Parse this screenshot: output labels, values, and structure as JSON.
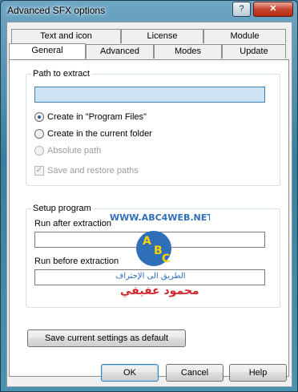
{
  "window": {
    "title": "Advanced SFX options"
  },
  "titlebar": {
    "help_label": "?",
    "close_label": "✕"
  },
  "tabs": {
    "row1": [
      "Text and icon",
      "License",
      "Module"
    ],
    "row2": [
      "General",
      "Advanced",
      "Modes",
      "Update"
    ],
    "active": "General"
  },
  "path_group": {
    "label": "Path to extract",
    "path_value": "",
    "options": [
      {
        "label": "Create in \"Program Files\"",
        "selected": true,
        "enabled": true
      },
      {
        "label": "Create in the current folder",
        "selected": false,
        "enabled": true
      },
      {
        "label": "Absolute path",
        "selected": false,
        "enabled": false
      }
    ],
    "save_restore": {
      "label": "Save and restore paths",
      "checked": true,
      "enabled": false
    }
  },
  "setup_group": {
    "label": "Setup program",
    "run_after_label": "Run after extraction",
    "run_after_value": "",
    "run_before_label": "Run before extraction",
    "run_before_value": ""
  },
  "save_default_button": "Save current settings as default",
  "footer": {
    "ok": "OK",
    "cancel": "Cancel",
    "help": "Help"
  },
  "watermark": {
    "url": "WWW.ABC4WEB.NET",
    "logo_letters": [
      "A",
      "B",
      "C"
    ],
    "arabic_line1": "الطريق الى الإحتراف",
    "arabic_line2": "محمود عفيفي"
  },
  "colors": {
    "focused_field": "#cbe3f5",
    "watermark_blue": "#2f6fb8",
    "watermark_red": "#d2262b"
  }
}
